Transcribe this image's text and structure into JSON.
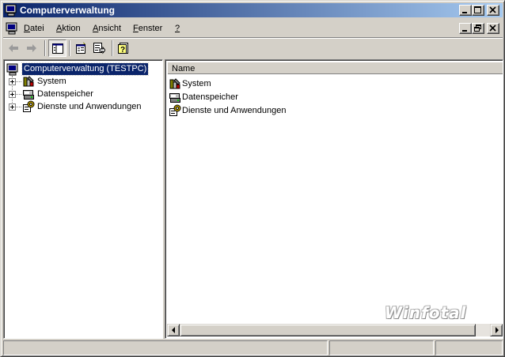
{
  "window": {
    "title": "Computerverwaltung"
  },
  "menu": {
    "items": [
      {
        "label": "Datei",
        "accel": "D",
        "rest": "atei"
      },
      {
        "label": "Aktion",
        "accel": "A",
        "rest": "ktion"
      },
      {
        "label": "Ansicht",
        "accel": "A",
        "rest": "nsicht"
      },
      {
        "label": "Fenster",
        "accel": "F",
        "rest": "enster"
      },
      {
        "label": "?",
        "accel": "?",
        "rest": ""
      }
    ]
  },
  "toolbar": {
    "buttons": [
      "back-icon",
      "forward-icon",
      "show-hide-tree-icon",
      "properties-icon",
      "export-list-icon",
      "help-icon"
    ]
  },
  "tree": {
    "root": {
      "label": "Computerverwaltung (TESTPC)",
      "icon": "computer-icon"
    },
    "children": [
      {
        "label": "System",
        "icon": "system-tools-icon"
      },
      {
        "label": "Datenspeicher",
        "icon": "storage-icon"
      },
      {
        "label": "Dienste und Anwendungen",
        "icon": "services-icon"
      }
    ]
  },
  "list": {
    "column_header": "Name",
    "items": [
      {
        "label": "System",
        "icon": "system-tools-icon"
      },
      {
        "label": "Datenspeicher",
        "icon": "storage-icon"
      },
      {
        "label": "Dienste und Anwendungen",
        "icon": "services-icon"
      }
    ]
  },
  "watermark": "Winfotal",
  "status": {
    "cells": [
      "",
      "",
      ""
    ]
  },
  "colors": {
    "title_start": "#0a246a",
    "title_end": "#a6caf0",
    "selection": "#0a246a",
    "face": "#d4d0c8"
  }
}
